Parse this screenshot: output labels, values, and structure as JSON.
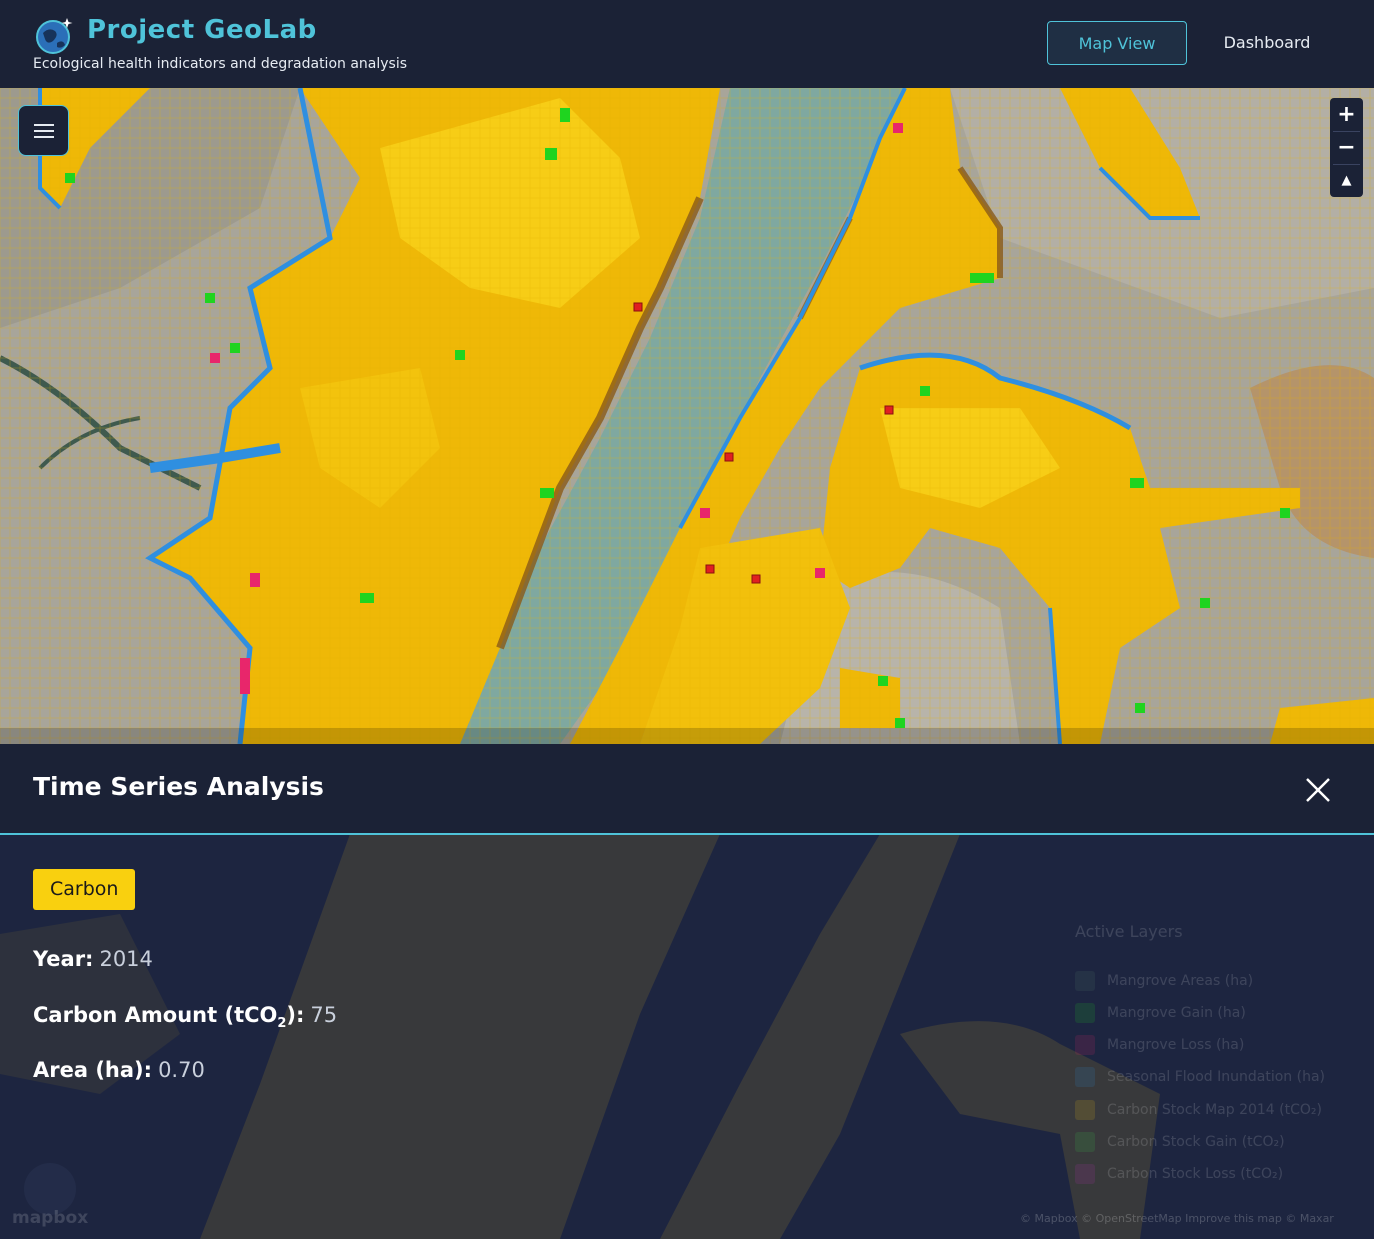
{
  "header": {
    "title": "Project GeoLab",
    "subtitle": "Ecological health indicators and degradation analysis",
    "nav": {
      "map_view": "Map View",
      "dashboard": "Dashboard"
    }
  },
  "map": {
    "controls": {
      "zoom_in": "+",
      "zoom_out": "−",
      "compass": "▲"
    }
  },
  "panel": {
    "title": "Time Series Analysis",
    "badge": "Carbon",
    "stats": {
      "year_label": "Year:",
      "year_value": "2014",
      "carbon_label_prefix": "Carbon Amount (tCO",
      "carbon_label_sub": "2",
      "carbon_label_suffix": "):",
      "carbon_value": "75",
      "area_label": "Area (ha):",
      "area_value": "0.70"
    }
  },
  "legend": {
    "title": "Active Layers",
    "items": [
      {
        "label": "Mangrove Areas (ha)",
        "color": "#5b7f6a"
      },
      {
        "label": "Mangrove Gain (ha)",
        "color": "#1fd41f"
      },
      {
        "label": "Mangrove Loss (ha)",
        "color": "#e8266b"
      },
      {
        "label": "Seasonal Flood Inundation (ha)",
        "color": "#2f8fe0"
      },
      {
        "label": "Carbon Stock Map 2014 (tCO₂)",
        "color": "#f5c518"
      },
      {
        "label": "Carbon Stock Gain (tCO₂)",
        "color": "#3cd04a"
      },
      {
        "label": "Carbon Stock Loss (tCO₂)",
        "color": "#c22fbd"
      }
    ]
  },
  "attribution": "© Mapbox © OpenStreetMap Improve this map © Maxar",
  "mapbox_logo": "mapbox",
  "colors": {
    "accent": "#4fc3d9",
    "carbon": "#f9d00f",
    "water": "#7fa8a0"
  }
}
